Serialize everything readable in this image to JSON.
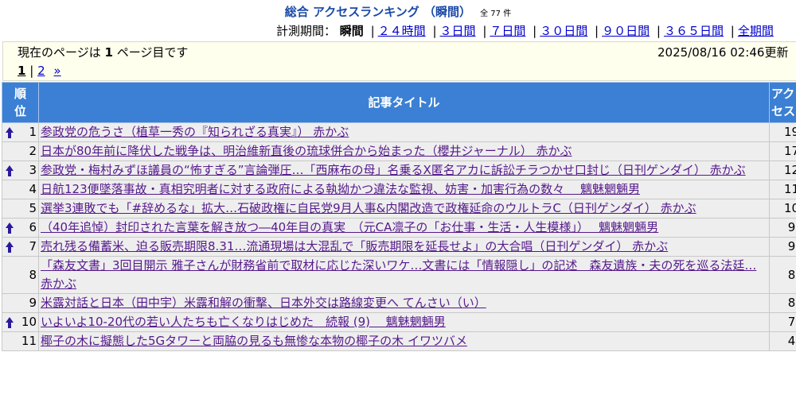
{
  "header": {
    "title": "総合 アクセスランキング （瞬間）",
    "count": "全 77 件",
    "period_label": "計測期間：",
    "current_period": "瞬間",
    "periods": [
      "２４時間",
      "３日間",
      "７日間",
      "３０日間",
      "９０日間",
      "３６５日間",
      "全期間"
    ]
  },
  "info": {
    "current_page_pre": "現在のページは",
    "current_page_num": "1",
    "current_page_post": "ページ目です",
    "updated": "2025/08/16 02:46更新",
    "pager": {
      "current": "1",
      "sep": "|",
      "next_page": "2",
      "next_symbol": "»"
    }
  },
  "table": {
    "headers": {
      "rank": "順位",
      "title": "記事タイトル",
      "access": "アクセス"
    },
    "rows": [
      {
        "rank": "1",
        "up": true,
        "title": "参政党の危うさ（植草一秀の『知られざる真実』） 赤かぶ",
        "access": "19"
      },
      {
        "rank": "2",
        "up": false,
        "title": "日本が80年前に降伏した戦争は、明治維新直後の琉球併合から始まった（櫻井ジャーナル） 赤かぶ",
        "access": "17"
      },
      {
        "rank": "3",
        "up": true,
        "title": "参政党・梅村みずほ議員の“怖すぎる”言論弾圧…「西麻布の母」名乗るX匿名アカに訴訟チラつかせ口封じ（日刊ゲンダイ） 赤かぶ",
        "access": "12"
      },
      {
        "rank": "4",
        "up": false,
        "title": "日航123便墜落事故・真相究明者に対する政府による執拗かつ違法な監視、妨害・加害行為の数々　 魑魅魍魎男",
        "access": "11"
      },
      {
        "rank": "5",
        "up": false,
        "title": "選挙3連敗でも「#辞めるな」拡大…石破政権に自民党9月人事&内閣改造で政権延命のウルトラC（日刊ゲンダイ） 赤かぶ",
        "access": "10"
      },
      {
        "rank": "6",
        "up": true,
        "title": "（40年追悼）封印された言葉を解き放つ―40年目の真実　（元CA凛子の「お仕事・生活・人生模様」）　 魑魅魍魎男",
        "access": "9"
      },
      {
        "rank": "7",
        "up": true,
        "title": "売れ残る備蓄米、迫る販売期限8.31…流通現場は大混乱で「販売期限を延長せよ」の大合唱（日刊ゲンダイ） 赤かぶ",
        "access": "9"
      },
      {
        "rank": "8",
        "up": false,
        "title": "「森友文書」3回目開示 雅子さんが財務省前で取材に応じた深いワケ…文書には「情報隠し」の記述　森友遺族・夫の死を巡る法廷… 赤かぶ",
        "access": "8"
      },
      {
        "rank": "9",
        "up": false,
        "title": "米露対話と日本（田中宇）米露和解の衝撃、日本外交は路線変更へ てんさい（い）",
        "access": "8"
      },
      {
        "rank": "10",
        "up": true,
        "title": "いよいよ10-20代の若い人たちも亡くなりはじめた　続報 (9)　 魑魅魍魎男",
        "access": "7"
      },
      {
        "rank": "11",
        "up": false,
        "title": "椰子の木に擬態した5Gタワーと両脇の見るも無惨な本物の椰子の木 イワツバメ",
        "access": "4"
      }
    ]
  }
}
